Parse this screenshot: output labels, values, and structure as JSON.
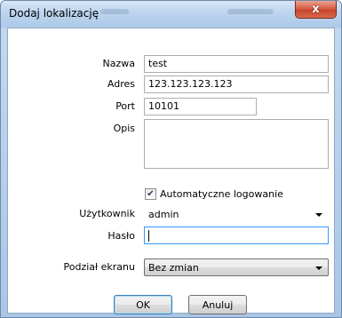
{
  "window": {
    "title": "Dodaj lokalizację",
    "close_glyph": "x"
  },
  "form": {
    "name_label": "Nazwa",
    "name_value": "test",
    "address_label": "Adres",
    "address_value": "123.123.123.123",
    "port_label": "Port",
    "port_value": "10101",
    "description_label": "Opis",
    "description_value": "",
    "autologin_label": "Automatyczne logowanie",
    "autologin_checked": true,
    "checkmark_glyph": "✔",
    "user_label": "Użytkownik",
    "user_value": "admin",
    "password_label": "Hasło",
    "password_value": "",
    "split_label": "Podział ekranu",
    "split_value": "Bez zmian"
  },
  "buttons": {
    "ok_label": "OK",
    "cancel_label": "Anuluj"
  }
}
